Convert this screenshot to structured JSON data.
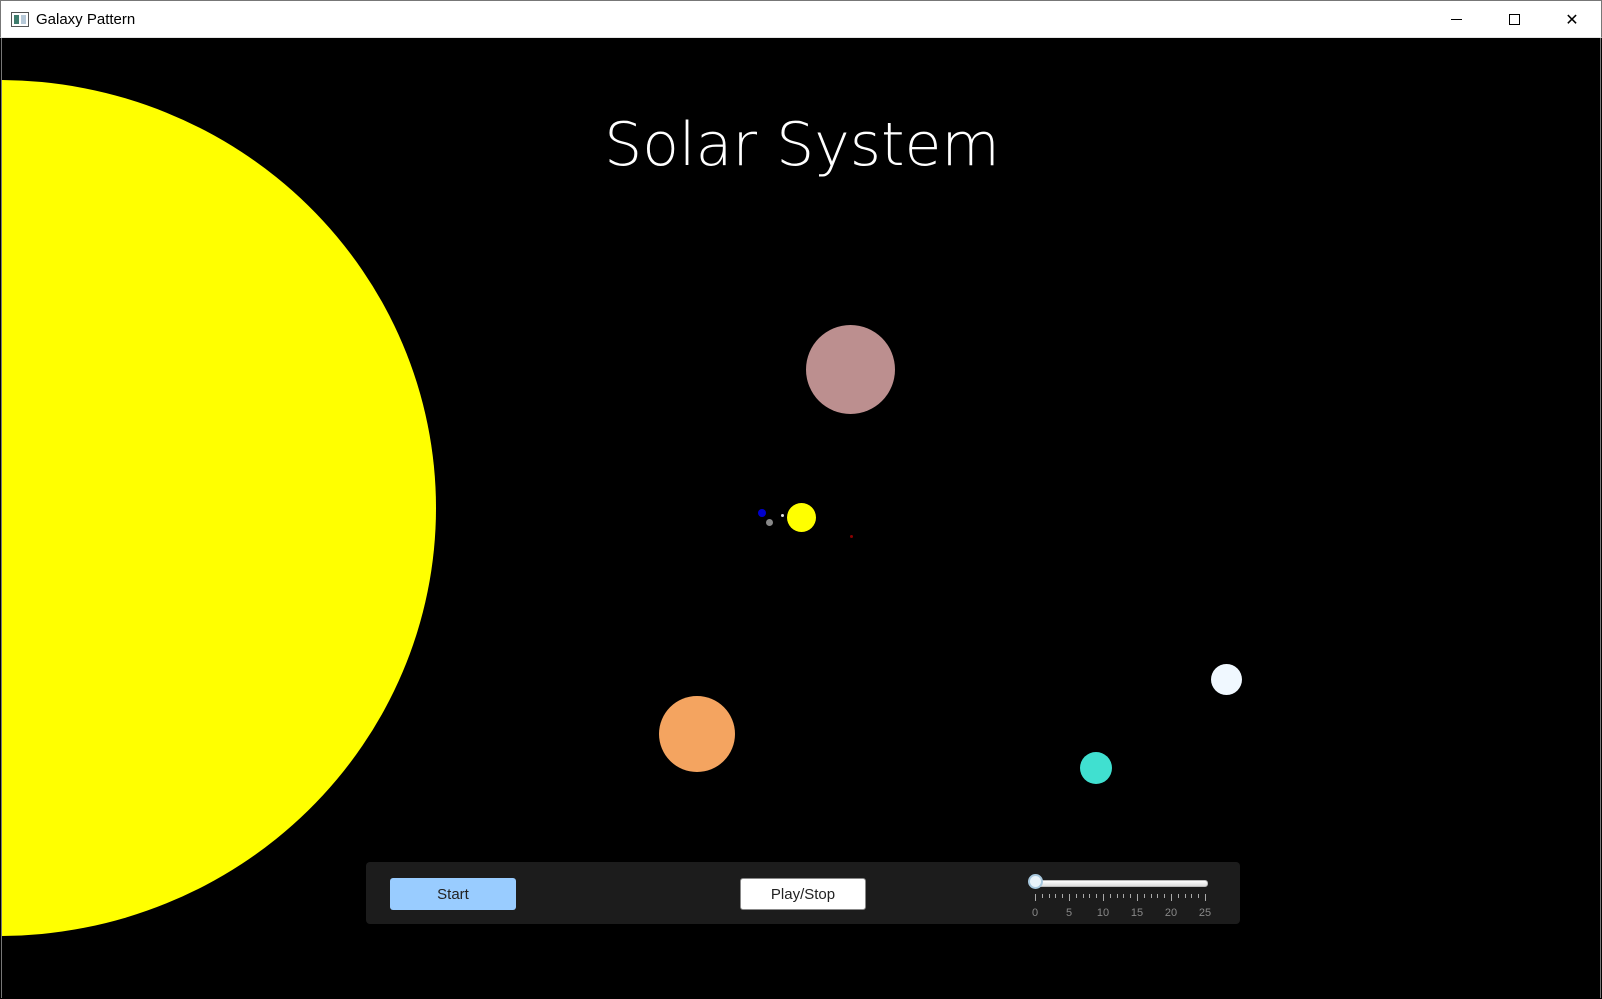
{
  "window": {
    "title": "Galaxy Pattern"
  },
  "page": {
    "title": "Solar System"
  },
  "bodies": [
    {
      "name": "sun",
      "color": "#ffff00"
    },
    {
      "name": "pink-planet",
      "color": "#bc8f8f"
    },
    {
      "name": "small-yellow-star",
      "color": "#ffff00"
    },
    {
      "name": "blue-moon",
      "color": "#0000cc"
    },
    {
      "name": "gray-moon",
      "color": "#888888"
    },
    {
      "name": "white-speck",
      "color": "#dddddd"
    },
    {
      "name": "red-speck",
      "color": "#8b0000"
    },
    {
      "name": "orange-planet",
      "color": "#f4a460"
    },
    {
      "name": "white-planet",
      "color": "#f0f8ff"
    },
    {
      "name": "turquoise-planet",
      "color": "#40e0d0"
    }
  ],
  "controls": {
    "start_label": "Start",
    "play_stop_label": "Play/Stop",
    "slider": {
      "value": 0,
      "min": 0,
      "max": 25,
      "tick_labels": [
        "0",
        "5",
        "10",
        "15",
        "20",
        "25"
      ]
    }
  }
}
